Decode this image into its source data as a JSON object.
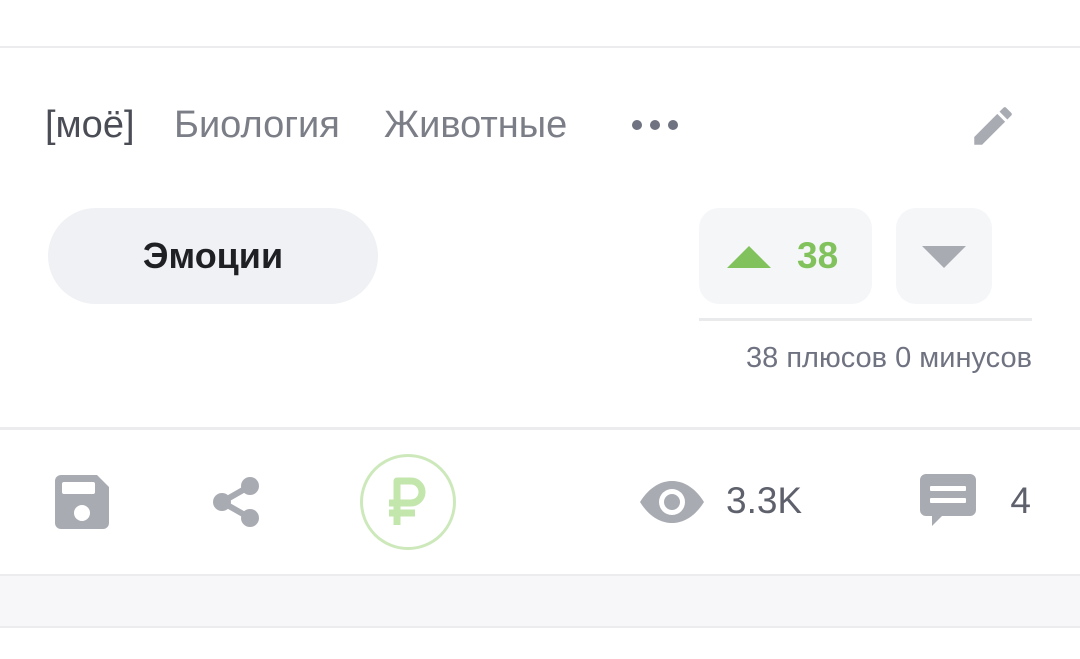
{
  "tags": [
    {
      "label": "[моё]"
    },
    {
      "label": "Биология"
    },
    {
      "label": "Животные"
    }
  ],
  "icons": {
    "more": "more-dots-icon",
    "edit": "pencil-icon",
    "vote_up": "triangle-up-icon",
    "vote_down": "triangle-down-icon",
    "save": "floppy-disk-icon",
    "share": "share-icon",
    "donate": "ruble-icon",
    "views": "eye-icon",
    "comments": "comment-icon"
  },
  "community": {
    "label": "Эмоции"
  },
  "rating": {
    "count": "38",
    "detail": "38 плюсов 0 минусов"
  },
  "actions": {
    "views_count": "3.3K",
    "comments_count": "4"
  },
  "colors": {
    "accent_green": "#82c25c",
    "icon_gray": "#a9abb3",
    "text_gray": "#7b7e86"
  }
}
